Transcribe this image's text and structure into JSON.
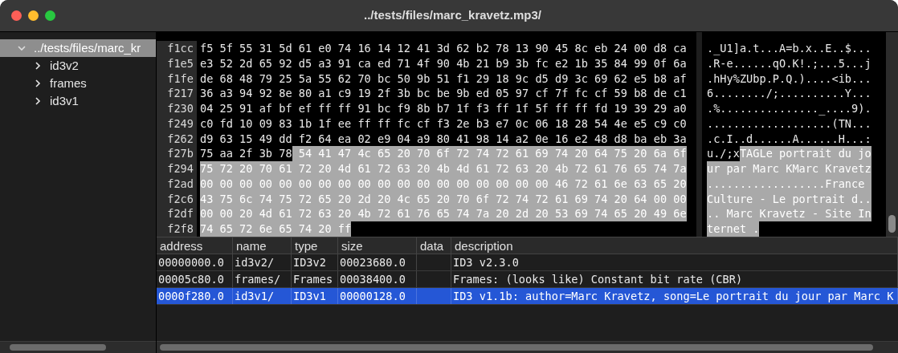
{
  "window": {
    "title": "../tests/files/marc_kravetz.mp3/"
  },
  "tree": [
    {
      "label": "../tests/files/marc_kr",
      "expanded": true,
      "selected": true,
      "children": [
        {
          "label": "id3v2",
          "expanded": false,
          "selected": false
        },
        {
          "label": "frames",
          "expanded": false,
          "selected": false
        },
        {
          "label": "id3v1",
          "expanded": false,
          "selected": false
        }
      ]
    }
  ],
  "hex_view": {
    "rows": [
      {
        "offset": "f1cc",
        "segments": [
          {
            "hex": "f5 5f 55 31 5d 61 e0 74 16 14 12 41 3d 62 b2 78 13 90 45 8c eb 24 00 d8 ca",
            "ascii": "._U1]a.t...A=b.x..E..$...",
            "selected": false
          }
        ]
      },
      {
        "offset": "f1e5",
        "segments": [
          {
            "hex": "e3 52 2d 65 92 d5 a3 91 ca ed 71 4f 90 4b 21 b9 3b fc e2 1b 35 84 99 0f 6a",
            "ascii": ".R-e......qO.K!.;...5...j",
            "selected": false
          }
        ]
      },
      {
        "offset": "f1fe",
        "segments": [
          {
            "hex": "de 68 48 79 25 5a 55 62 70 bc 50 9b 51 f1 29 18 9c d5 d9 3c 69 62 e5 b8 af",
            "ascii": ".hHy%ZUbp.P.Q.)....<ib...",
            "selected": false
          }
        ]
      },
      {
        "offset": "f217",
        "segments": [
          {
            "hex": "36 a3 94 92 8e 80 a1 c9 19 2f 3b bc be 9b ed 05 97 cf 7f fc cf 59 b8 de c1",
            "ascii": "6......../;..........Y...",
            "selected": false
          }
        ]
      },
      {
        "offset": "f230",
        "segments": [
          {
            "hex": "04 25 91 af bf ef ff ff 91 bc f9 8b b7 1f f3 ff 1f 5f ff ff fd 19 39 29 a0",
            "ascii": ".%..............._....9).",
            "selected": false
          }
        ]
      },
      {
        "offset": "f249",
        "segments": [
          {
            "hex": "c0 fd 10 09 83 1b 1f ee ff ff fc cf f3 2e b3 e7 0c 06 18 28 54 4e e5 c9 c0",
            "ascii": "...................(TN...",
            "selected": false
          }
        ]
      },
      {
        "offset": "f262",
        "segments": [
          {
            "hex": "d9 63 15 49 dd f2 64 ea 02 e9 04 a9 80 41 98 14 a2 0e 16 e2 48 d8 ba eb 3a",
            "ascii": ".c.I..d......A......H...:",
            "selected": false
          }
        ]
      },
      {
        "offset": "f27b",
        "segments": [
          {
            "hex": "75 aa 2f 3b 78",
            "ascii": "u./;x",
            "selected": false
          },
          {
            "hex": "54 41 47 4c 65 20 70 6f 72 74 72 61 69 74 20 64 75 20 6a 6f",
            "ascii": "TAGLe portrait du jo",
            "selected": true
          }
        ]
      },
      {
        "offset": "f294",
        "segments": [
          {
            "hex": "75 72 20 70 61 72 20 4d 61 72 63 20 4b 4d 61 72 63 20 4b 72 61 76 65 74 7a",
            "ascii": "ur par Marc KMarc Kravetz",
            "selected": true
          }
        ]
      },
      {
        "offset": "f2ad",
        "segments": [
          {
            "hex": "00 00 00 00 00 00 00 00 00 00 00 00 00 00 00 00 00 00 46 72 61 6e 63 65 20",
            "ascii": "..................France ",
            "selected": true
          }
        ]
      },
      {
        "offset": "f2c6",
        "segments": [
          {
            "hex": "43 75 6c 74 75 72 65 20 2d 20 4c 65 20 70 6f 72 74 72 61 69 74 20 64 00 00",
            "ascii": "Culture - Le portrait d..",
            "selected": true
          }
        ]
      },
      {
        "offset": "f2df",
        "segments": [
          {
            "hex": "00 00 20 4d 61 72 63 20 4b 72 61 76 65 74 7a 20 2d 20 53 69 74 65 20 49 6e",
            "ascii": ".. Marc Kravetz - Site In",
            "selected": true
          }
        ]
      },
      {
        "offset": "f2f8",
        "segments": [
          {
            "hex": "74 65 72 6e 65 74 20 ff",
            "ascii": "ternet .",
            "selected": true
          }
        ]
      }
    ]
  },
  "table": {
    "columns": [
      "address",
      "name",
      "type",
      "size",
      "data",
      "description"
    ],
    "rows": [
      {
        "cells": [
          "00000000.0",
          "id3v2/",
          "ID3v2",
          "00023680.0",
          "",
          "ID3 v2.3.0"
        ],
        "selected": false
      },
      {
        "cells": [
          "00005c80.0",
          "frames/",
          "Frames",
          "00038400.0",
          "",
          "Frames: (looks like) Constant bit rate (CBR)"
        ],
        "selected": false
      },
      {
        "cells": [
          "0000f280.0",
          "id3v1/",
          "ID3v1",
          "00000128.0",
          "",
          "ID3 v1.1b: author=Marc Kravetz, song=Le portrait du jour par Marc K"
        ],
        "selected": true
      }
    ]
  }
}
